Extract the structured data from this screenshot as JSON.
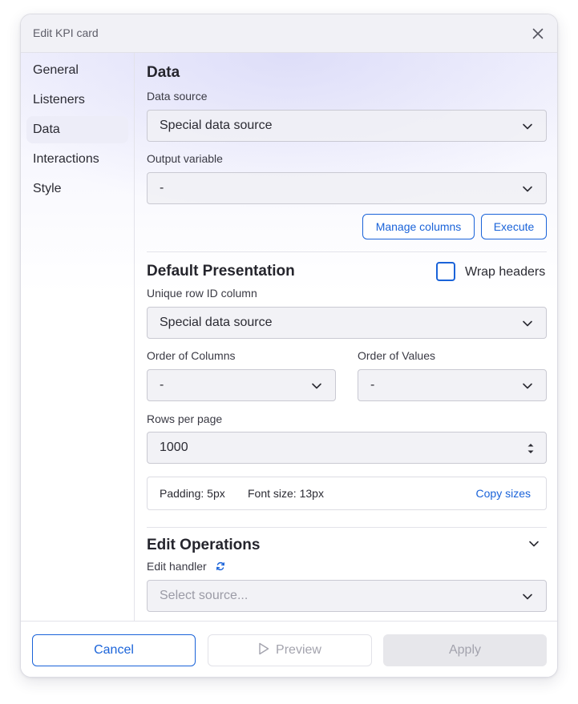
{
  "dialog": {
    "title": "Edit KPI card",
    "close_icon": "close-icon"
  },
  "sidebar": {
    "items": [
      {
        "label": "General",
        "active": false
      },
      {
        "label": "Listeners",
        "active": false
      },
      {
        "label": "Data",
        "active": true
      },
      {
        "label": "Interactions",
        "active": false
      },
      {
        "label": "Style",
        "active": false
      }
    ]
  },
  "data_section": {
    "title": "Data",
    "data_source_label": "Data source",
    "data_source_value": "Special data source",
    "output_variable_label": "Output variable",
    "output_variable_value": "-",
    "manage_columns_label": "Manage columns",
    "execute_label": "Execute"
  },
  "presentation": {
    "title": "Default Presentation",
    "wrap_headers_label": "Wrap headers",
    "wrap_headers_checked": false,
    "unique_row_label": "Unique row ID column",
    "unique_row_value": "Special data source",
    "order_columns_label": "Order of Columns",
    "order_columns_value": "-",
    "order_values_label": "Order of Values",
    "order_values_value": "-",
    "rows_per_page_label": "Rows per page",
    "rows_per_page_value": "1000",
    "padding_text": "Padding: 5px",
    "font_size_text": "Font size: 13px",
    "copy_sizes_label": "Copy sizes"
  },
  "edit_operations": {
    "title": "Edit Operations",
    "edit_handler_label": "Edit handler",
    "select_placeholder": "Select source..."
  },
  "footer": {
    "cancel_label": "Cancel",
    "preview_label": "Preview",
    "apply_label": "Apply"
  },
  "colors": {
    "accent": "#1a63d9",
    "active_sidebar_bg": "#ededf8",
    "disabled_text": "#a3a3ad"
  }
}
